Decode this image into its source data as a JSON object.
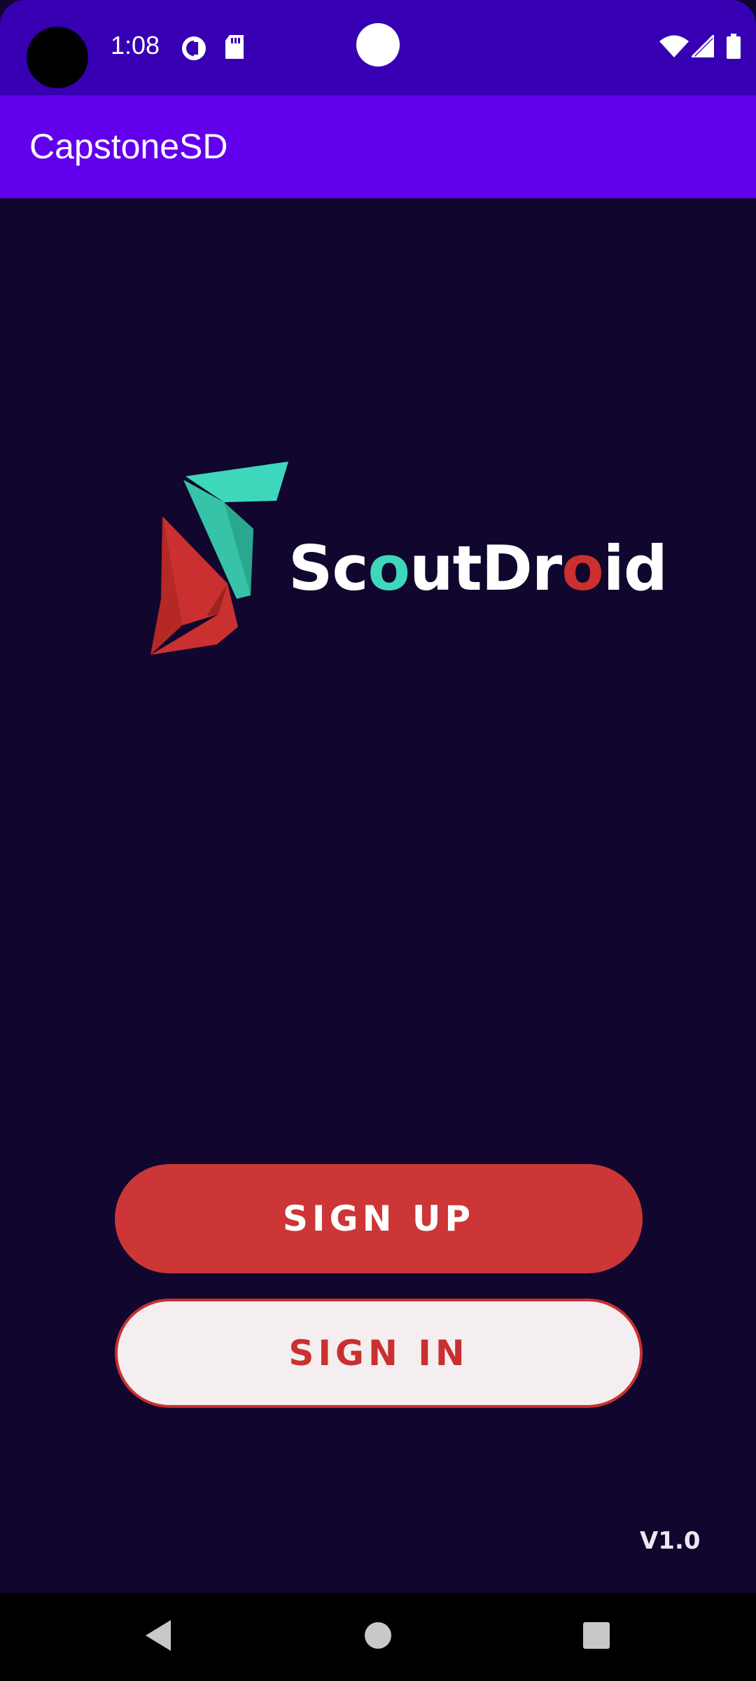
{
  "status_bar": {
    "time": "1:08",
    "icons": [
      "camera-cutout-icon",
      "data-saver-icon",
      "sd-card-icon",
      "wifi-icon",
      "signal-icon",
      "battery-icon"
    ]
  },
  "app_bar": {
    "title": "CapstoneSD"
  },
  "logo": {
    "text_part1": "Sc",
    "text_part2": "o",
    "text_part3": "utDr",
    "text_part4": "o",
    "text_part5": "id"
  },
  "buttons": {
    "sign_up": "SIGN UP",
    "sign_in": "SIGN IN"
  },
  "version": "V1.0",
  "colors": {
    "background": "#10062e",
    "status_bar": "#3700b3",
    "app_bar": "#6200ee",
    "accent_red": "#cc3636",
    "accent_teal": "#3fd7bc"
  },
  "nav_bar": {
    "icons": [
      "back-icon",
      "home-icon",
      "recents-icon"
    ]
  }
}
